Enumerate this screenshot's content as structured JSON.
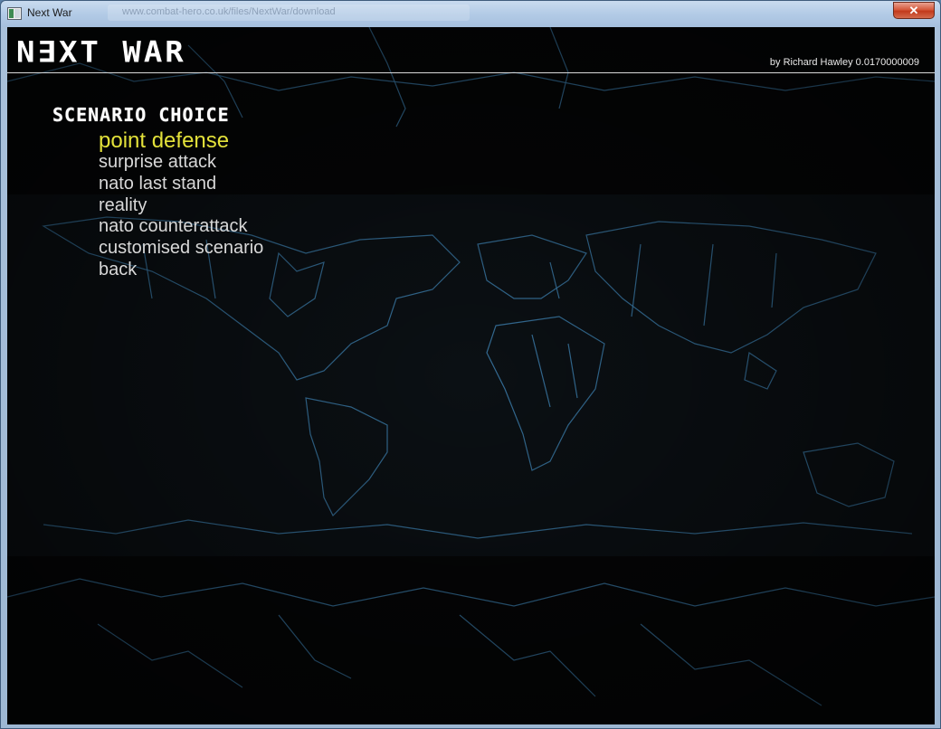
{
  "window": {
    "title": "Next War",
    "url_hint": "www.combat-hero.co.uk/files/NextWar/download"
  },
  "header": {
    "logo": "N∃XT WAR",
    "credit": "by Richard Hawley 0.0170000009"
  },
  "menu": {
    "heading": "SCENARIO CHOICE",
    "selected_index": 0,
    "items": [
      {
        "label": "point defense"
      },
      {
        "label": "surprise attack"
      },
      {
        "label": "nato last stand"
      },
      {
        "label": "reality"
      },
      {
        "label": "nato counterattack"
      },
      {
        "label": "customised scenario"
      },
      {
        "label": "back"
      }
    ]
  },
  "colors": {
    "selected": "#e3e13a",
    "item": "#d8d8d8",
    "map_lines": "#3d7fae",
    "background": "#000000"
  }
}
